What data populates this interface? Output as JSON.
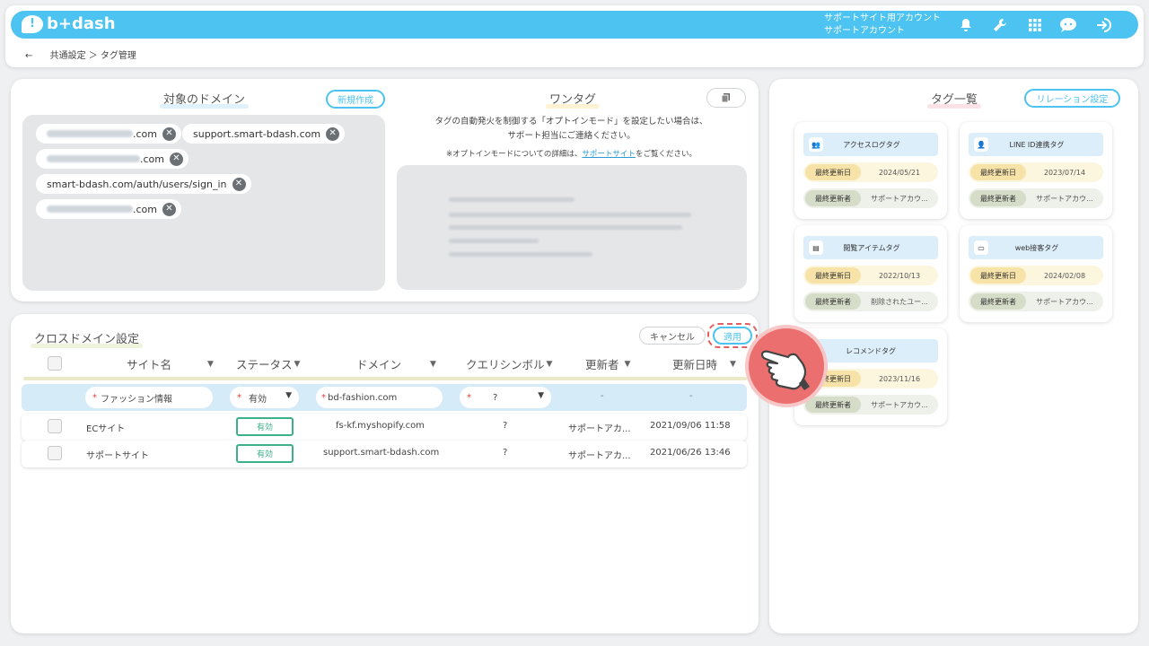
{
  "header": {
    "logo": "b+dash",
    "account_line1": "サポートサイト用アカウント",
    "account_line2": "サポートアカウント",
    "icons": [
      "bell-icon",
      "wrench-icon",
      "grid-icon",
      "chat-icon",
      "logout-icon"
    ]
  },
  "breadcrumb": {
    "back": "←",
    "path": "共通設定 ＞ タグ管理"
  },
  "domains": {
    "title": "対象のドメイン",
    "new_button": "新規作成",
    "items": [
      {
        "suffix": ".com"
      },
      {
        "suffix": "support.smart-bdash.com"
      },
      {
        "suffix": ".com"
      },
      {
        "suffix": "smart-bdash.com/auth/users/sign_in"
      },
      {
        "suffix": ".com"
      }
    ]
  },
  "onetag": {
    "title": "ワンタグ",
    "desc1": "タグの自動発火を制御する「オプトインモード」を設定したい場合は、",
    "desc2": "サポート担当にご連絡ください。",
    "note_pre": "※オプトインモードについての詳細は、",
    "note_link": "サポートサイト",
    "note_post": "をご覧ください。"
  },
  "tag_list": {
    "title": "タグ一覧",
    "relation_button": "リレーション設定",
    "cards": [
      {
        "name": "アクセスログタグ",
        "icon": "people-icon",
        "updated_label": "最終更新日",
        "updated": "2024/05/21",
        "updater_label": "最終更新者",
        "updater": "サポートアカウ..."
      },
      {
        "name": "LINE ID連携タグ",
        "icon": "person-icon",
        "updated_label": "最終更新日",
        "updated": "2023/07/14",
        "updater_label": "最終更新者",
        "updater": "サポートアカウ..."
      },
      {
        "name": "閲覧アイテムタグ",
        "icon": "doc-icon",
        "updated_label": "最終更新日",
        "updated": "2022/10/13",
        "updater_label": "最終更新者",
        "updater": "削除されたユー..."
      },
      {
        "name": "web接客タグ",
        "icon": "monitor-icon",
        "updated_label": "最終更新日",
        "updated": "2024/02/08",
        "updater_label": "最終更新者",
        "updater": "サポートアカウ..."
      },
      {
        "name": "レコメンドタグ",
        "icon": "",
        "updated_label": "最終更新日",
        "updated": "2023/11/16",
        "updater_label": "最終更新者",
        "updater": "サポートアカウ..."
      }
    ]
  },
  "cross_domain": {
    "title": "クロスドメイン設定",
    "cancel": "キャンセル",
    "apply": "適用",
    "columns": [
      "サイト名",
      "ステータス",
      "ドメイン",
      "クエリシンボル",
      "更新者",
      "更新日時"
    ],
    "filter": {
      "site": "ファッション情報",
      "status": "有効",
      "domain": "bd-fashion.com",
      "symbol": "?",
      "updater": "-",
      "updated": "-"
    },
    "rows": [
      {
        "site": "ECサイト",
        "status": "有効",
        "domain": "fs-kf.myshopify.com",
        "symbol": "?",
        "updater": "サポートアカ...",
        "updated": "2021/09/06 11:58"
      },
      {
        "site": "サポートサイト",
        "status": "有効",
        "domain": "support.smart-bdash.com",
        "symbol": "?",
        "updater": "サポートアカ...",
        "updated": "2021/06/26 13:46"
      }
    ]
  },
  "colors": {
    "brand": "#4cc3f0",
    "status_green": "#3bb08a",
    "highlight": "#e46060"
  }
}
